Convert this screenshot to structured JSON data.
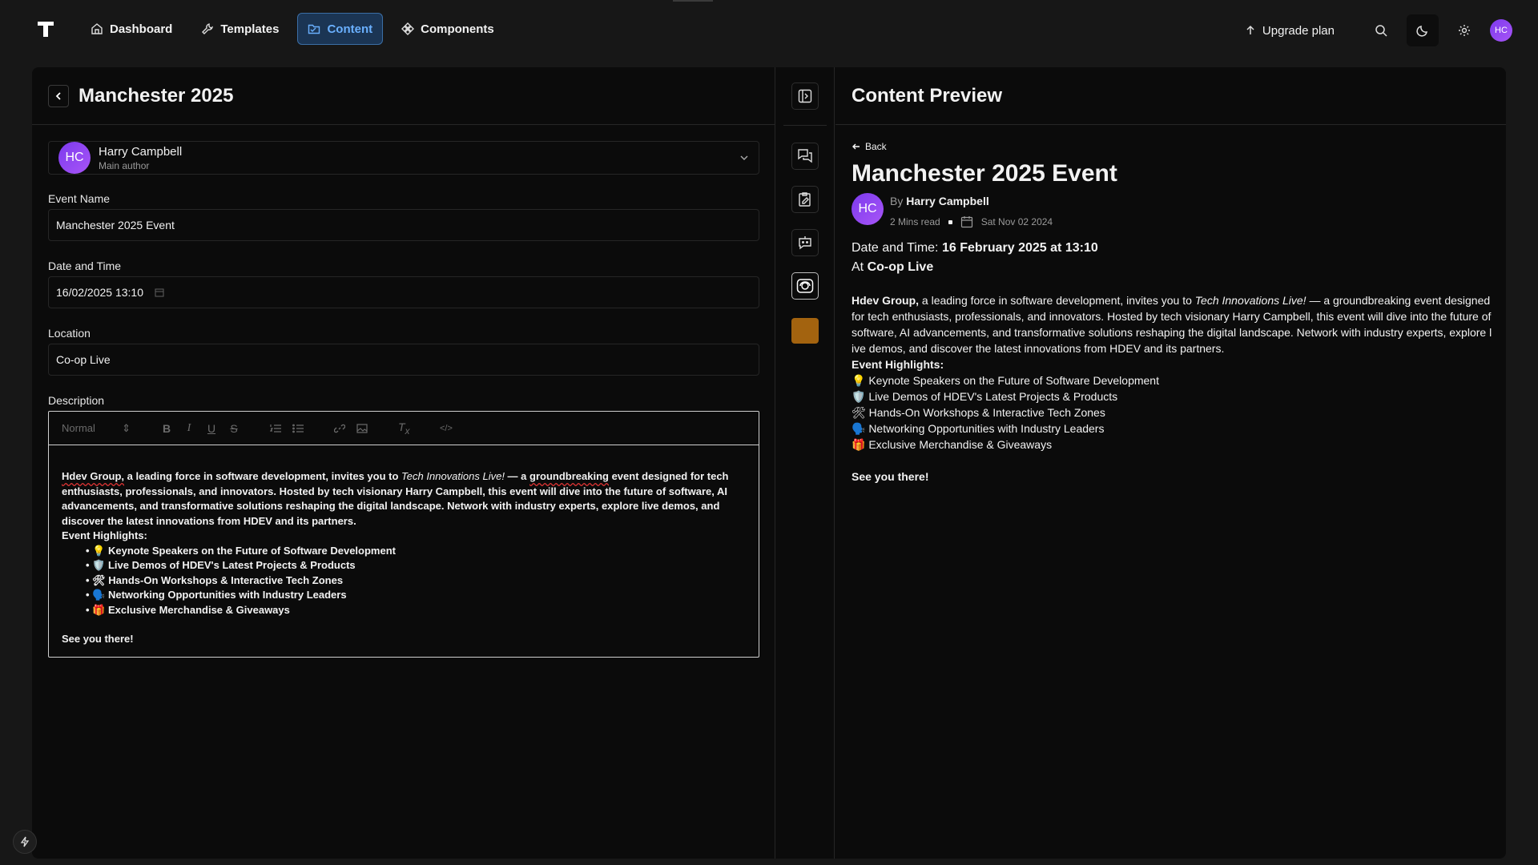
{
  "nav": {
    "items": [
      {
        "label": "Dashboard",
        "icon": "home-icon"
      },
      {
        "label": "Templates",
        "icon": "wrench-icon"
      },
      {
        "label": "Content",
        "icon": "folder-icon",
        "active": true
      },
      {
        "label": "Components",
        "icon": "components-icon"
      }
    ],
    "upgrade_label": "Upgrade plan",
    "avatar_initials": "HC"
  },
  "editor": {
    "title": "Manchester 2025",
    "author": {
      "initials": "HC",
      "name": "Harry Campbell",
      "role": "Main author"
    },
    "event_name": {
      "label": "Event Name",
      "value": "Manchester 2025 Event"
    },
    "date_time": {
      "label": "Date and Time",
      "value": "16/02/2025 13:10"
    },
    "location": {
      "label": "Location",
      "value": "Co-op Live"
    },
    "description": {
      "label": "Description",
      "format_select": "Normal",
      "intro_bold": "Hdev Group,",
      "intro_a": " a leading force in software development, invites you to ",
      "intro_em": "Tech Innovations Live!",
      "intro_b": " — a ",
      "intro_spell": "groundbreaking",
      "intro_c": " event designed for tech enthusiasts, professionals, and innovators. Hosted by tech visionary Harry Campbell, this event will dive into the future of software, AI advancements, and transformative solutions reshaping the digital landscape. Network with industry experts, explore live demos, and discover the latest innovations from HDEV and its partners.",
      "highlights_heading": "Event Highlights:",
      "highlights": [
        "💡 Keynote Speakers on the Future of Software Development",
        "🛡️ Live Demos of HDEV's Latest Projects & Products",
        "🛠 Hands-On Workshops & Interactive Tech Zones",
        "🗣️ Networking Opportunities with Industry Leaders",
        "🎁 Exclusive Merchandise & Giveaways"
      ],
      "closing": "See you there!"
    }
  },
  "rail": {
    "icons": [
      "sidebar-toggle-icon",
      "chat-icon",
      "clipboard-edit-icon",
      "bot-icon",
      "camera-lens-icon"
    ],
    "swatch_color": "#a3630f"
  },
  "preview": {
    "title": "Content Preview",
    "back_label": "Back",
    "heading": "Manchester 2025 Event",
    "by_label": "By",
    "author": "Harry Campbell",
    "initials": "HC",
    "read_time": "2 Mins read",
    "date": "Sat Nov 02 2024",
    "date_time_label": "Date and Time: ",
    "date_time_value": "16 February 2025 at 13:10",
    "at_label": "At ",
    "location": "Co-op Live",
    "intro_bold": "Hdev Group,",
    "intro_a": " a leading force in software development, invites you to ",
    "intro_em": "Tech Innovations Live!",
    "intro_b": " — a groundbreaking event designed for tech enthusiasts, professionals, and innovators. Hosted by tech visionary Harry Campbell, this event will dive into the future of software, AI advancements, and transformative solutions reshaping the digital landscape. Network with industry experts, explore live demos, and discover the latest innovations from HDEV and its partners.",
    "highlights_heading": "Event Highlights:",
    "highlights": [
      "💡 Keynote Speakers on the Future of Software Development",
      "🛡️ Live Demos of HDEV's Latest Projects & Products",
      "🛠 Hands-On Workshops & Interactive Tech Zones",
      "🗣️ Networking Opportunities with Industry Leaders",
      "🎁 Exclusive Merchandise & Giveaways"
    ],
    "closing": "See you there!"
  },
  "colors": {
    "accent": "#6ab0ff",
    "avatar": "#8b5cf6",
    "swatch": "#a3630f"
  }
}
